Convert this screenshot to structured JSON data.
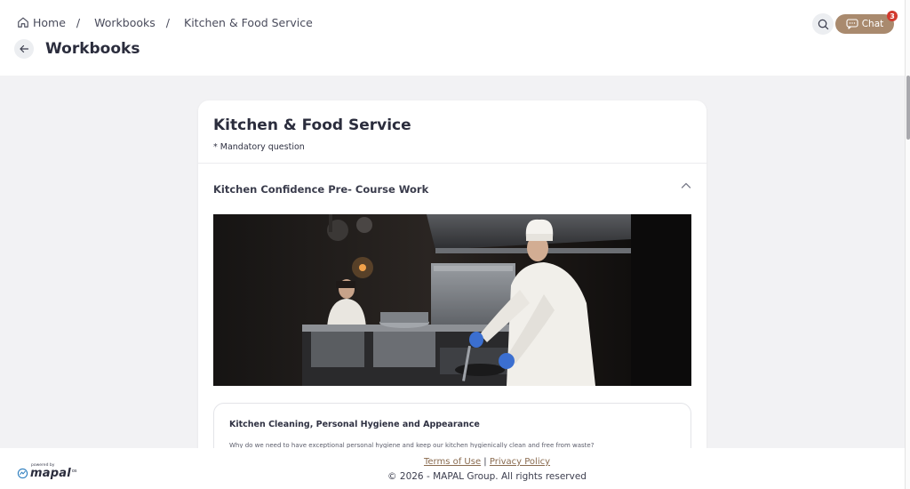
{
  "header": {
    "breadcrumb": [
      {
        "label": "Home",
        "icon": "home-icon"
      },
      {
        "label": "Workbooks"
      },
      {
        "label": "Kitchen & Food Service"
      }
    ],
    "separator": "/",
    "title": "Workbooks",
    "chat_label": "Chat",
    "chat_badge": "3"
  },
  "card": {
    "title": "Kitchen & Food Service",
    "mandatory_note": "* Mandatory question",
    "section": {
      "title": "Kitchen Confidence Pre- Course Work",
      "expanded": true,
      "image_description": "chef-cooking-in-kitchen"
    },
    "question": {
      "title": "Kitchen Cleaning, Personal Hygiene and Appearance",
      "text": "Why do we need to have exceptional personal hygiene and keep our kitchen hygienically clean and free from waste?"
    }
  },
  "footer": {
    "powered_by": "powered by",
    "brand": "mapal",
    "brand_suffix": "os",
    "terms_label": "Terms of Use",
    "link_separator": "|",
    "privacy_label": "Privacy Policy",
    "copyright": "© 2026 - MAPAL Group. All rights reserved"
  },
  "colors": {
    "accent": "#a98a6e",
    "badge": "#d23a2e",
    "link": "#8a6b4f",
    "background": "#f2f2f4"
  }
}
